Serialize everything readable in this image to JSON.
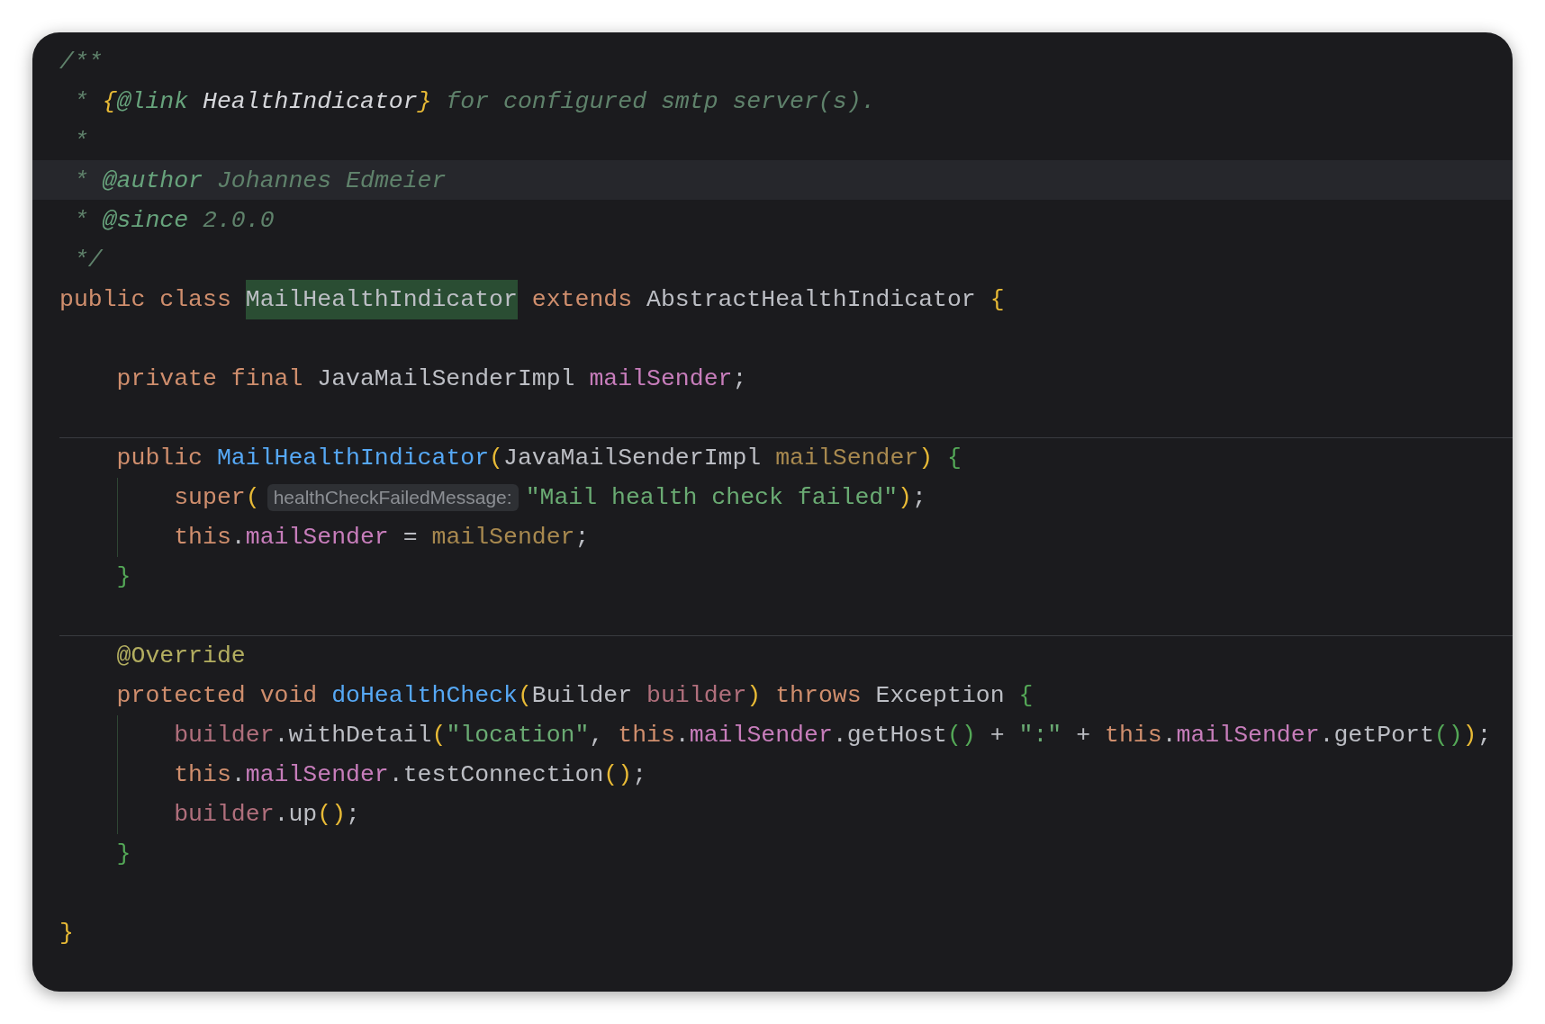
{
  "editor": {
    "lines": [
      {
        "current": false,
        "separator": false,
        "guide": false,
        "tokens": [
          {
            "kind": "comment",
            "text": "/**"
          }
        ]
      },
      {
        "current": false,
        "separator": false,
        "guide": false,
        "tokens": [
          {
            "kind": "comment",
            "text": " * "
          },
          {
            "kind": "doc_brace",
            "text": "{"
          },
          {
            "kind": "doc_tag",
            "text": "@link "
          },
          {
            "kind": "doc_ref",
            "text": "HealthIndicator"
          },
          {
            "kind": "doc_brace",
            "text": "}"
          },
          {
            "kind": "comment",
            "text": " for configured smtp server(s)."
          }
        ]
      },
      {
        "current": false,
        "separator": false,
        "guide": false,
        "tokens": [
          {
            "kind": "comment",
            "text": " *"
          }
        ]
      },
      {
        "current": true,
        "separator": false,
        "guide": false,
        "tokens": [
          {
            "kind": "comment",
            "text": " * "
          },
          {
            "kind": "doc_tag",
            "text": "@author "
          },
          {
            "kind": "comment",
            "text": "Johannes Edmeier"
          }
        ]
      },
      {
        "current": false,
        "separator": false,
        "guide": false,
        "tokens": [
          {
            "kind": "comment",
            "text": " * "
          },
          {
            "kind": "doc_tag",
            "text": "@since "
          },
          {
            "kind": "comment",
            "text": "2.0.0"
          }
        ]
      },
      {
        "current": false,
        "separator": false,
        "guide": false,
        "tokens": [
          {
            "kind": "comment",
            "text": " */"
          }
        ]
      },
      {
        "current": false,
        "separator": false,
        "guide": false,
        "tokens": [
          {
            "kind": "keyword",
            "text": "public class "
          },
          {
            "kind": "highlight",
            "text": "MailHealthIndicator"
          },
          {
            "kind": "keyword",
            "text": " extends "
          },
          {
            "kind": "plain",
            "text": "AbstractHealthIndicator "
          },
          {
            "kind": "brace_yellow",
            "text": "{"
          }
        ]
      },
      {
        "current": false,
        "separator": false,
        "guide": false
      },
      {
        "current": false,
        "separator": false,
        "guide": false,
        "tokens": [
          {
            "kind": "keyword",
            "text": "    private final "
          },
          {
            "kind": "plain",
            "text": "JavaMailSenderImpl "
          },
          {
            "kind": "field",
            "text": "mailSender"
          },
          {
            "kind": "plain",
            "text": ";"
          }
        ]
      },
      {
        "current": false,
        "separator": false,
        "guide": false
      },
      {
        "current": false,
        "separator": true,
        "guide": false,
        "tokens": [
          {
            "kind": "keyword",
            "text": "    public "
          },
          {
            "kind": "method",
            "text": "MailHealthIndicator"
          },
          {
            "kind": "brace_yellow",
            "text": "("
          },
          {
            "kind": "plain",
            "text": "JavaMailSenderImpl "
          },
          {
            "kind": "parameter",
            "text": "mailSender"
          },
          {
            "kind": "brace_yellow",
            "text": ")"
          },
          {
            "kind": "brace_green",
            "text": " {"
          }
        ]
      },
      {
        "current": false,
        "separator": false,
        "guide": true,
        "tokens": [
          {
            "kind": "keyword",
            "text": "        super"
          },
          {
            "kind": "brace_yellow",
            "text": "("
          },
          {
            "kind": "hint",
            "text": "healthCheckFailedMessage:"
          },
          {
            "kind": "string",
            "text": "\"Mail health check failed\""
          },
          {
            "kind": "brace_yellow",
            "text": ")"
          },
          {
            "kind": "plain",
            "text": ";"
          }
        ]
      },
      {
        "current": false,
        "separator": false,
        "guide": true,
        "tokens": [
          {
            "kind": "keyword",
            "text": "        this"
          },
          {
            "kind": "plain",
            "text": "."
          },
          {
            "kind": "field",
            "text": "mailSender"
          },
          {
            "kind": "plain",
            "text": " = "
          },
          {
            "kind": "parameter",
            "text": "mailSender"
          },
          {
            "kind": "plain",
            "text": ";"
          }
        ]
      },
      {
        "current": false,
        "separator": false,
        "guide": false,
        "tokens": [
          {
            "kind": "brace_green",
            "text": "    }"
          }
        ]
      },
      {
        "current": false,
        "separator": false,
        "guide": false
      },
      {
        "current": false,
        "separator": true,
        "guide": false,
        "tokens": [
          {
            "kind": "annotation",
            "text": "    @Override"
          }
        ]
      },
      {
        "current": false,
        "separator": false,
        "guide": false,
        "tokens": [
          {
            "kind": "keyword",
            "text": "    protected void "
          },
          {
            "kind": "method",
            "text": "doHealthCheck"
          },
          {
            "kind": "brace_yellow",
            "text": "("
          },
          {
            "kind": "plain",
            "text": "Builder "
          },
          {
            "kind": "variable",
            "text": "builder"
          },
          {
            "kind": "brace_yellow",
            "text": ")"
          },
          {
            "kind": "keyword",
            "text": " throws "
          },
          {
            "kind": "plain",
            "text": "Exception "
          },
          {
            "kind": "brace_green",
            "text": "{"
          }
        ]
      },
      {
        "current": false,
        "separator": false,
        "guide": true,
        "tokens": [
          {
            "kind": "variable",
            "text": "        builder"
          },
          {
            "kind": "plain",
            "text": ".withDetail"
          },
          {
            "kind": "brace_yellow",
            "text": "("
          },
          {
            "kind": "string",
            "text": "\"location\""
          },
          {
            "kind": "plain",
            "text": ", "
          },
          {
            "kind": "keyword",
            "text": "this"
          },
          {
            "kind": "plain",
            "text": "."
          },
          {
            "kind": "field",
            "text": "mailSender"
          },
          {
            "kind": "plain",
            "text": ".getHost"
          },
          {
            "kind": "brace_green",
            "text": "()"
          },
          {
            "kind": "plain",
            "text": " + "
          },
          {
            "kind": "string",
            "text": "\":\""
          },
          {
            "kind": "plain",
            "text": " + "
          },
          {
            "kind": "keyword",
            "text": "this"
          },
          {
            "kind": "plain",
            "text": "."
          },
          {
            "kind": "field",
            "text": "mailSender"
          },
          {
            "kind": "plain",
            "text": ".getPort"
          },
          {
            "kind": "brace_green",
            "text": "()"
          },
          {
            "kind": "brace_yellow",
            "text": ")"
          },
          {
            "kind": "plain",
            "text": ";"
          }
        ]
      },
      {
        "current": false,
        "separator": false,
        "guide": true,
        "tokens": [
          {
            "kind": "keyword",
            "text": "        this"
          },
          {
            "kind": "plain",
            "text": "."
          },
          {
            "kind": "field",
            "text": "mailSender"
          },
          {
            "kind": "plain",
            "text": ".testConnection"
          },
          {
            "kind": "brace_yellow",
            "text": "()"
          },
          {
            "kind": "plain",
            "text": ";"
          }
        ]
      },
      {
        "current": false,
        "separator": false,
        "guide": true,
        "tokens": [
          {
            "kind": "variable",
            "text": "        builder"
          },
          {
            "kind": "plain",
            "text": ".up"
          },
          {
            "kind": "brace_yellow",
            "text": "()"
          },
          {
            "kind": "plain",
            "text": ";"
          }
        ]
      },
      {
        "current": false,
        "separator": false,
        "guide": false,
        "tokens": [
          {
            "kind": "brace_green",
            "text": "    }"
          }
        ]
      },
      {
        "current": false,
        "separator": false,
        "guide": false
      },
      {
        "current": false,
        "separator": false,
        "guide": false,
        "tokens": [
          {
            "kind": "brace_yellow",
            "text": "}"
          }
        ]
      }
    ]
  }
}
